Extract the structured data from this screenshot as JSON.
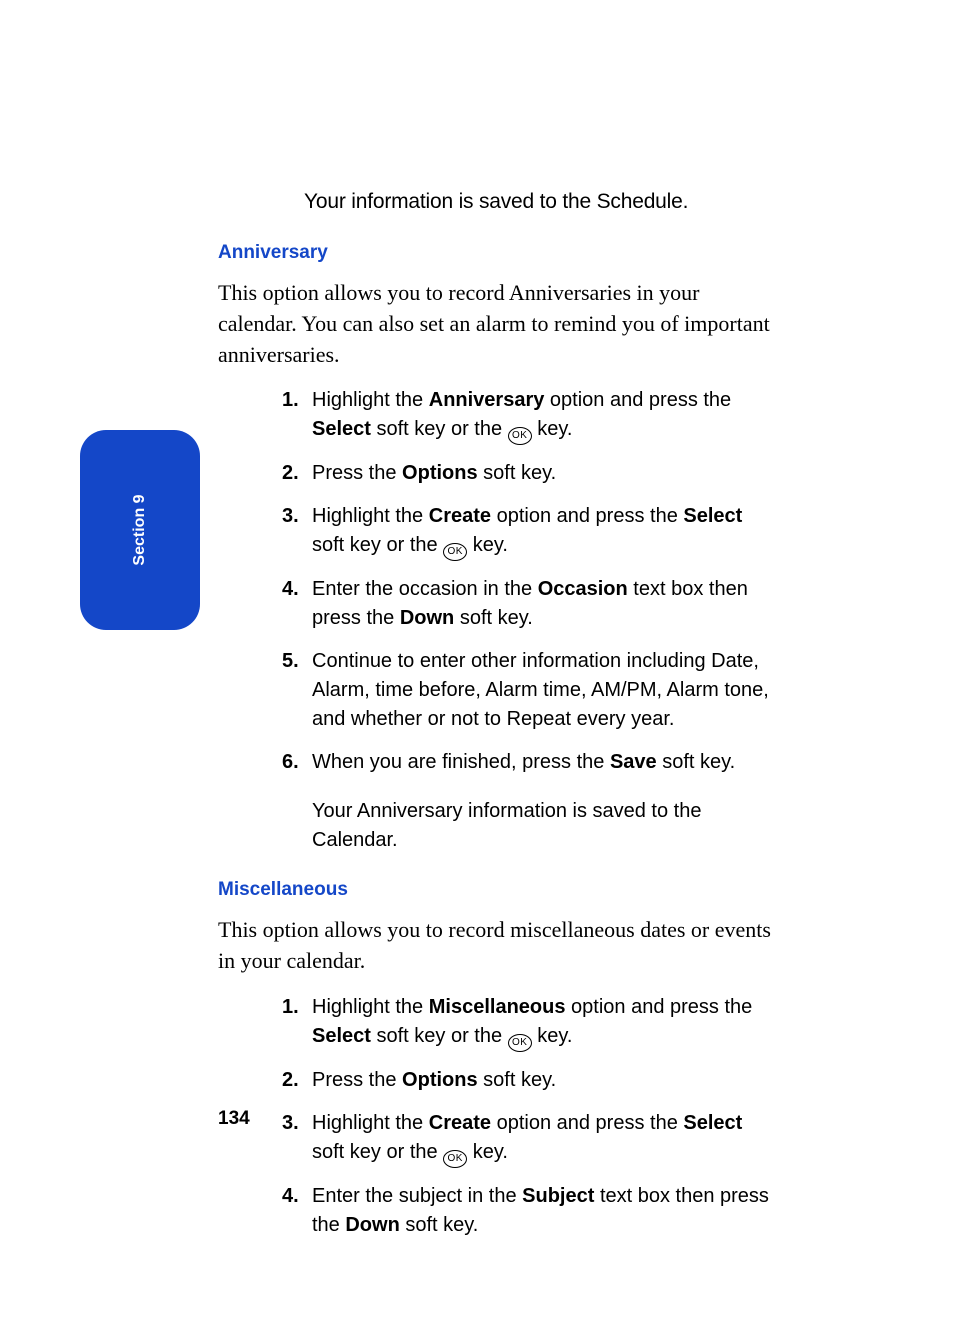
{
  "tab_label": "Section 9",
  "page_number": "134",
  "intro_line": "Your information is saved to the Schedule.",
  "ok_glyph": "OK",
  "sections": {
    "anniversary": {
      "heading": "Anniversary",
      "description": "This option allows you to record Anniversaries in your calendar. You can also set an alarm to remind you of important anniversaries.",
      "steps": [
        {
          "n": "1.",
          "pre": "Highlight the ",
          "b1": "Anniversary",
          "mid": " option and press the ",
          "b2": "Select",
          "post": " soft key or the ",
          "ok": true,
          "post2": " key."
        },
        {
          "n": "2.",
          "pre": "Press the ",
          "b1": "Options",
          "post": " soft key."
        },
        {
          "n": "3.",
          "pre": "Highlight the ",
          "b1": "Create",
          "mid": " option and press the ",
          "b2": "Select",
          "post": " soft key or the ",
          "ok": true,
          "post2": " key."
        },
        {
          "n": "4.",
          "pre": "Enter the occasion in the ",
          "b1": "Occasion",
          "mid": " text box then press the ",
          "b2": "Down",
          "post": " soft key."
        },
        {
          "n": "5.",
          "pre": "Continue to enter other information including Date, Alarm, time before, Alarm time, AM/PM, Alarm tone, and whether or not to Repeat every year."
        },
        {
          "n": "6.",
          "pre": "When you are finished, press the ",
          "b1": "Save",
          "post": " soft key."
        }
      ],
      "trailing": "Your Anniversary information is saved to the Calendar."
    },
    "misc": {
      "heading": "Miscellaneous",
      "description": "This option allows you to record miscellaneous dates or events in your calendar.",
      "steps": [
        {
          "n": "1.",
          "pre": "Highlight the ",
          "b1": "Miscellaneous",
          "mid": " option and press the ",
          "b2": "Select",
          "post": " soft key or the ",
          "ok": true,
          "post2": " key."
        },
        {
          "n": "2.",
          "pre": "Press the ",
          "b1": "Options",
          "post": " soft key."
        },
        {
          "n": "3.",
          "pre": "Highlight the ",
          "b1": "Create",
          "mid": " option and press the ",
          "b2": "Select",
          "post": " soft key or the ",
          "ok": true,
          "post2": " key."
        },
        {
          "n": "4.",
          "pre": "Enter the subject in the ",
          "b1": "Subject",
          "mid": " text box then press the ",
          "b2": "Down",
          "post": " soft key."
        }
      ]
    }
  }
}
